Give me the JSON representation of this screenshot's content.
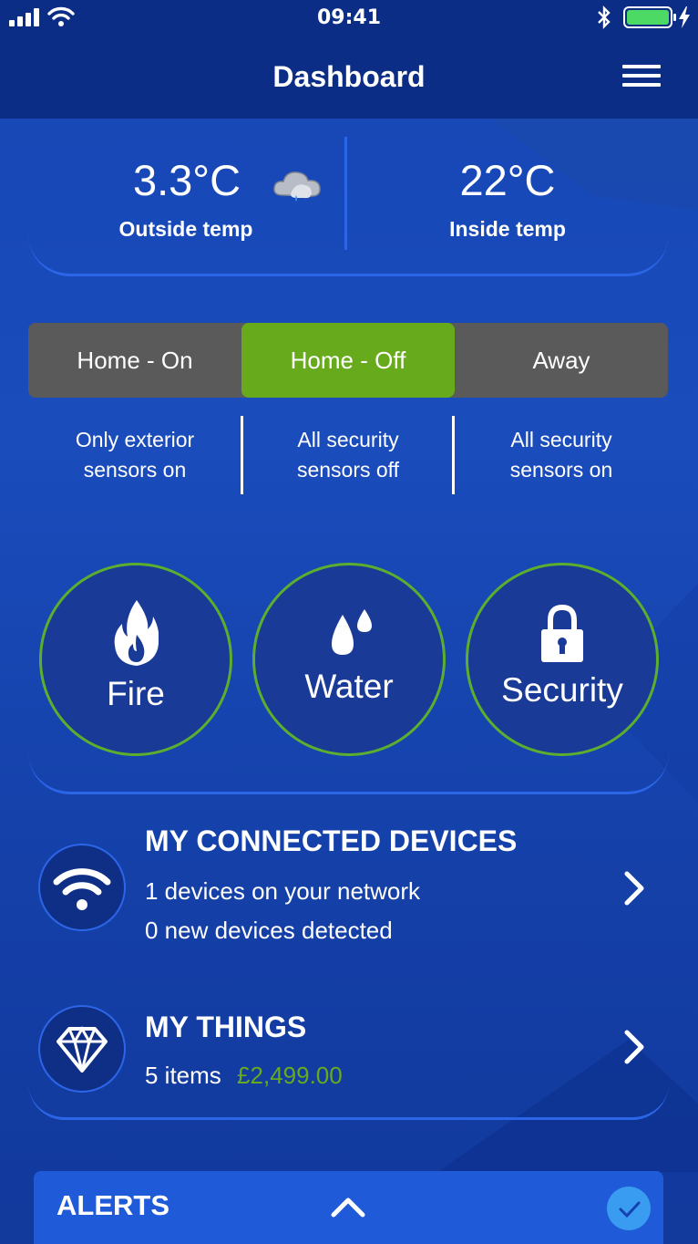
{
  "status_bar": {
    "time": "09:41"
  },
  "header": {
    "title": "Dashboard"
  },
  "temperature": {
    "outside_value": "3.3°C",
    "outside_label": "Outside temp",
    "inside_value": "22°C",
    "inside_label": "Inside temp"
  },
  "mode_selector": {
    "options": [
      {
        "label": "Home - On",
        "description": [
          "Only exterior",
          "sensors on"
        ]
      },
      {
        "label": "Home - Off",
        "description": [
          "All security",
          "sensors off"
        ]
      },
      {
        "label": "Away",
        "description": [
          "All security",
          "sensors on"
        ]
      }
    ],
    "selected": "Home - Off"
  },
  "categories": [
    {
      "label": "Fire",
      "icon": "flame-icon"
    },
    {
      "label": "Water",
      "icon": "water-drops-icon"
    },
    {
      "label": "Security",
      "icon": "padlock-icon"
    }
  ],
  "connected_devices": {
    "title": "MY CONNECTED DEVICES",
    "line1": "1 devices on your network",
    "line2": "0 new devices detected",
    "icon": "wifi-icon"
  },
  "my_things": {
    "title": "MY THINGS",
    "count": "5 items",
    "value": "£2,499.00",
    "icon": "diamond-icon"
  },
  "alerts": {
    "label": "ALERTS",
    "icon": "chevron-up-icon",
    "status_icon": "checkmark-icon"
  },
  "colors": {
    "background": "#1746b4",
    "navbar": "#0c2d86",
    "active_mode": "#67ab1d",
    "circle_border": "#5cae2e",
    "price": "#67ab1d",
    "battery": "#4cd964"
  }
}
